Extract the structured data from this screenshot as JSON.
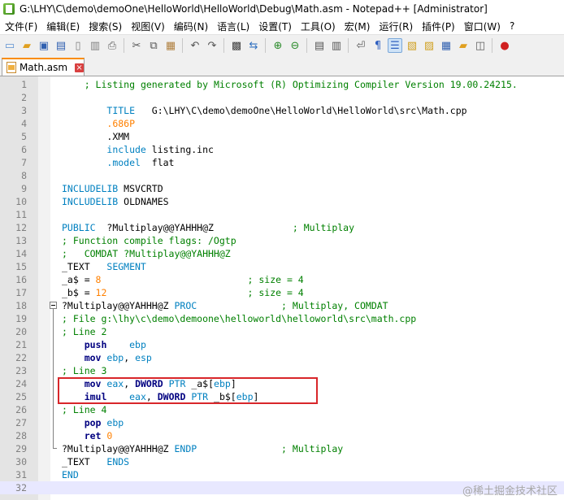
{
  "window": {
    "title": "G:\\LHY\\C\\demo\\demoOne\\HelloWorld\\HelloWorld\\Debug\\Math.asm - Notepad++ [Administrator]"
  },
  "menu": [
    "文件(F)",
    "编辑(E)",
    "搜索(S)",
    "视图(V)",
    "编码(N)",
    "语言(L)",
    "设置(T)",
    "工具(O)",
    "宏(M)",
    "运行(R)",
    "插件(P)",
    "窗口(W)",
    "?"
  ],
  "tab": {
    "label": "Math.asm",
    "close_icon": "close-icon"
  },
  "lines": [
    {
      "n": "1",
      "parts": [
        {
          "t": "; Listing generated by Microsoft (R) Optimizing Compiler Version 19.00.24215.",
          "c": "c-comment"
        }
      ],
      "indent": "    "
    },
    {
      "n": "2",
      "parts": [],
      "indent": ""
    },
    {
      "n": "3",
      "parts": [
        {
          "t": "TITLE",
          "c": "c-dirk"
        },
        {
          "t": "   G:\\LHY\\",
          "c": "c-txt"
        },
        {
          "t": "C",
          "c": "c-txt"
        },
        {
          "t": "\\demo\\demoOne\\HelloWorld\\HelloWorld\\src\\Math.cpp",
          "c": "c-txt"
        }
      ],
      "indent": "        "
    },
    {
      "n": "4",
      "parts": [
        {
          "t": ".686P",
          "c": "c-num"
        }
      ],
      "indent": "        "
    },
    {
      "n": "5",
      "parts": [
        {
          "t": ".XMM",
          "c": "c-txt"
        }
      ],
      "indent": "        "
    },
    {
      "n": "6",
      "parts": [
        {
          "t": "include",
          "c": "c-dirk"
        },
        {
          "t": " listing.inc",
          "c": "c-txt"
        }
      ],
      "indent": "        "
    },
    {
      "n": "7",
      "parts": [
        {
          "t": ".model",
          "c": "c-dirk"
        },
        {
          "t": "  flat",
          "c": "c-txt"
        }
      ],
      "indent": "        "
    },
    {
      "n": "8",
      "parts": [],
      "indent": ""
    },
    {
      "n": "9",
      "parts": [
        {
          "t": "INCLUDELIB",
          "c": "c-dirk"
        },
        {
          "t": " MSVCRTD",
          "c": "c-txt"
        }
      ],
      "indent": ""
    },
    {
      "n": "10",
      "parts": [
        {
          "t": "INCLUDELIB",
          "c": "c-dirk"
        },
        {
          "t": " OLDNAMES",
          "c": "c-txt"
        }
      ],
      "indent": ""
    },
    {
      "n": "11",
      "parts": [],
      "indent": ""
    },
    {
      "n": "12",
      "parts": [
        {
          "t": "PUBLIC",
          "c": "c-dirk"
        },
        {
          "t": "  ?Multiplay@@YAHHH@Z              ",
          "c": "c-txt"
        },
        {
          "t": "; Multiplay",
          "c": "c-comment"
        }
      ],
      "indent": ""
    },
    {
      "n": "13",
      "parts": [
        {
          "t": "; Function compile flags: /Ogtp",
          "c": "c-comment"
        }
      ],
      "indent": ""
    },
    {
      "n": "14",
      "parts": [
        {
          "t": ";   COMDAT ?Multiplay@@YAHHH@Z",
          "c": "c-comment"
        }
      ],
      "indent": ""
    },
    {
      "n": "15",
      "parts": [
        {
          "t": "_TEXT",
          "c": "c-txt"
        },
        {
          "t": "   SEGMENT",
          "c": "c-dirk"
        }
      ],
      "indent": ""
    },
    {
      "n": "16",
      "parts": [
        {
          "t": "_a$ = ",
          "c": "c-txt"
        },
        {
          "t": "8",
          "c": "c-num"
        },
        {
          "t": "                          ",
          "c": "c-txt"
        },
        {
          "t": "; size = 4",
          "c": "c-comment"
        }
      ],
      "indent": ""
    },
    {
      "n": "17",
      "parts": [
        {
          "t": "_b$ = ",
          "c": "c-txt"
        },
        {
          "t": "12",
          "c": "c-num"
        },
        {
          "t": "                         ",
          "c": "c-txt"
        },
        {
          "t": "; size = 4",
          "c": "c-comment"
        }
      ],
      "indent": ""
    },
    {
      "n": "18",
      "parts": [
        {
          "t": "?Multiplay@@YAHHH@Z ",
          "c": "c-txt"
        },
        {
          "t": "PROC",
          "c": "c-dirk"
        },
        {
          "t": "               ",
          "c": "c-txt"
        },
        {
          "t": "; Multiplay, COMDAT",
          "c": "c-comment"
        }
      ],
      "indent": ""
    },
    {
      "n": "19",
      "parts": [
        {
          "t": "; File g:\\lhy\\c\\demo\\demoone\\helloworld\\helloworld\\src\\math.cpp",
          "c": "c-comment"
        }
      ],
      "indent": ""
    },
    {
      "n": "20",
      "parts": [
        {
          "t": "; Line 2",
          "c": "c-comment"
        }
      ],
      "indent": ""
    },
    {
      "n": "21",
      "parts": [
        {
          "t": "push",
          "c": "c-op"
        },
        {
          "t": "    ",
          "c": "c-txt"
        },
        {
          "t": "ebp",
          "c": "c-reg"
        }
      ],
      "indent": "    "
    },
    {
      "n": "22",
      "parts": [
        {
          "t": "mov",
          "c": "c-op"
        },
        {
          "t": " ",
          "c": "c-txt"
        },
        {
          "t": "ebp",
          "c": "c-reg"
        },
        {
          "t": ", ",
          "c": "c-txt"
        },
        {
          "t": "esp",
          "c": "c-reg"
        }
      ],
      "indent": "    "
    },
    {
      "n": "23",
      "parts": [
        {
          "t": "; Line 3",
          "c": "c-comment"
        }
      ],
      "indent": ""
    },
    {
      "n": "24",
      "parts": [
        {
          "t": "mov",
          "c": "c-op"
        },
        {
          "t": " ",
          "c": "c-txt"
        },
        {
          "t": "eax",
          "c": "c-reg"
        },
        {
          "t": ", ",
          "c": "c-txt"
        },
        {
          "t": "DWORD",
          "c": "c-op"
        },
        {
          "t": " ",
          "c": "c-txt"
        },
        {
          "t": "PTR",
          "c": "c-dirk"
        },
        {
          "t": " _a$[",
          "c": "c-txt"
        },
        {
          "t": "ebp",
          "c": "c-reg"
        },
        {
          "t": "]",
          "c": "c-txt"
        }
      ],
      "indent": "    "
    },
    {
      "n": "25",
      "parts": [
        {
          "t": "imul",
          "c": "c-op"
        },
        {
          "t": "    ",
          "c": "c-txt"
        },
        {
          "t": "eax",
          "c": "c-reg"
        },
        {
          "t": ", ",
          "c": "c-txt"
        },
        {
          "t": "DWORD",
          "c": "c-op"
        },
        {
          "t": " ",
          "c": "c-txt"
        },
        {
          "t": "PTR",
          "c": "c-dirk"
        },
        {
          "t": " _b$[",
          "c": "c-txt"
        },
        {
          "t": "ebp",
          "c": "c-reg"
        },
        {
          "t": "]",
          "c": "c-txt"
        }
      ],
      "indent": "    "
    },
    {
      "n": "26",
      "parts": [
        {
          "t": "; Line 4",
          "c": "c-comment"
        }
      ],
      "indent": ""
    },
    {
      "n": "27",
      "parts": [
        {
          "t": "pop",
          "c": "c-op"
        },
        {
          "t": " ",
          "c": "c-txt"
        },
        {
          "t": "ebp",
          "c": "c-reg"
        }
      ],
      "indent": "    "
    },
    {
      "n": "28",
      "parts": [
        {
          "t": "ret",
          "c": "c-op"
        },
        {
          "t": " ",
          "c": "c-txt"
        },
        {
          "t": "0",
          "c": "c-num"
        }
      ],
      "indent": "    "
    },
    {
      "n": "29",
      "parts": [
        {
          "t": "?Multiplay@@YAHHH@Z ",
          "c": "c-txt"
        },
        {
          "t": "ENDP",
          "c": "c-dirk"
        },
        {
          "t": "               ",
          "c": "c-txt"
        },
        {
          "t": "; Multiplay",
          "c": "c-comment"
        }
      ],
      "indent": ""
    },
    {
      "n": "30",
      "parts": [
        {
          "t": "_TEXT",
          "c": "c-txt"
        },
        {
          "t": "   ENDS",
          "c": "c-dirk"
        }
      ],
      "indent": ""
    },
    {
      "n": "31",
      "parts": [
        {
          "t": "END",
          "c": "c-dirk"
        }
      ],
      "indent": ""
    },
    {
      "n": "32",
      "parts": [],
      "indent": "",
      "current": true
    }
  ],
  "watermark": "@稀土掘金技术社区"
}
